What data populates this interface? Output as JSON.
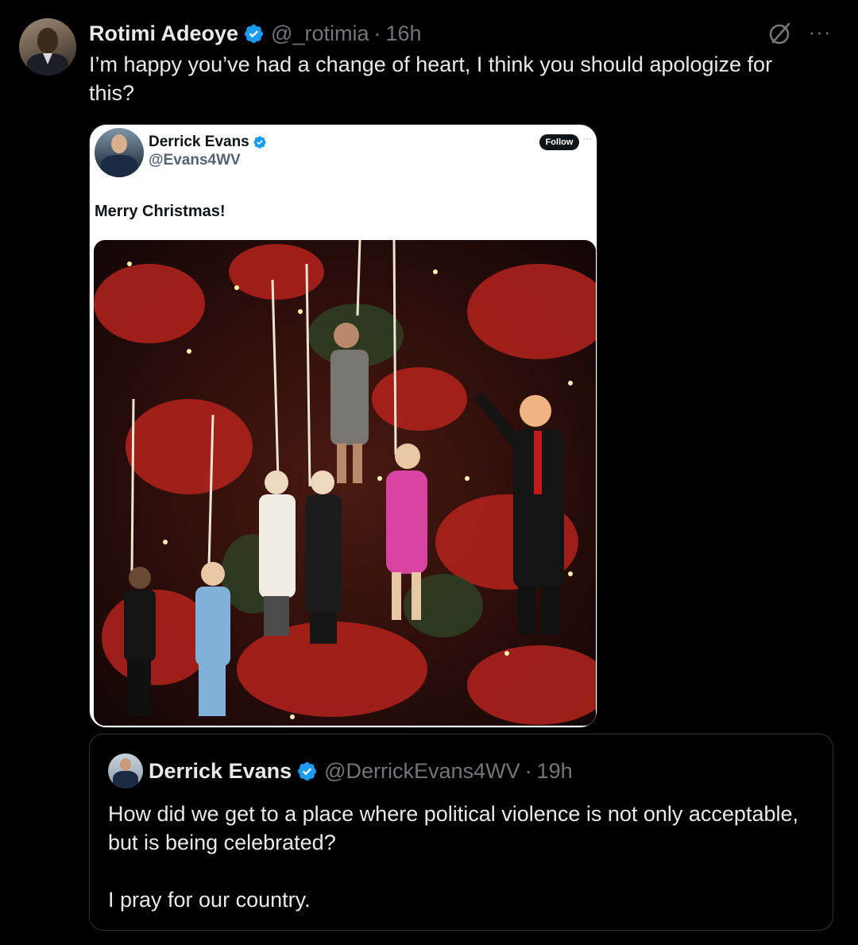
{
  "tweet": {
    "author": {
      "display_name": "Rotimi Adeoye",
      "handle": "@_rotimia",
      "verified": true
    },
    "separator": "·",
    "time": "16h",
    "text": "I’m happy you’ve had a change of heart, I think you should apologize for this?",
    "icons": [
      "grok-icon",
      "more-icon"
    ],
    "more_label": "···"
  },
  "embedded_screenshot": {
    "author": {
      "display_name": "Derrick Evans",
      "handle": "@Evans4WV",
      "verified": true
    },
    "follow_label": "Follow",
    "dots": "···",
    "text": "Merry Christmas!"
  },
  "quote": {
    "author": {
      "display_name": "Derrick Evans",
      "handle": "@DerrickEvans4WV",
      "verified": true
    },
    "separator": "·",
    "time": "19h",
    "text_line1": "How did we get to a place where political violence is not only acceptable, but is being celebrated?",
    "text_line2": "I pray for our country."
  },
  "colors": {
    "background": "#000000",
    "text_primary": "#e7e9ea",
    "text_secondary": "#71767b",
    "verified_blue": "#1d9bf0",
    "border": "#2f3336"
  }
}
